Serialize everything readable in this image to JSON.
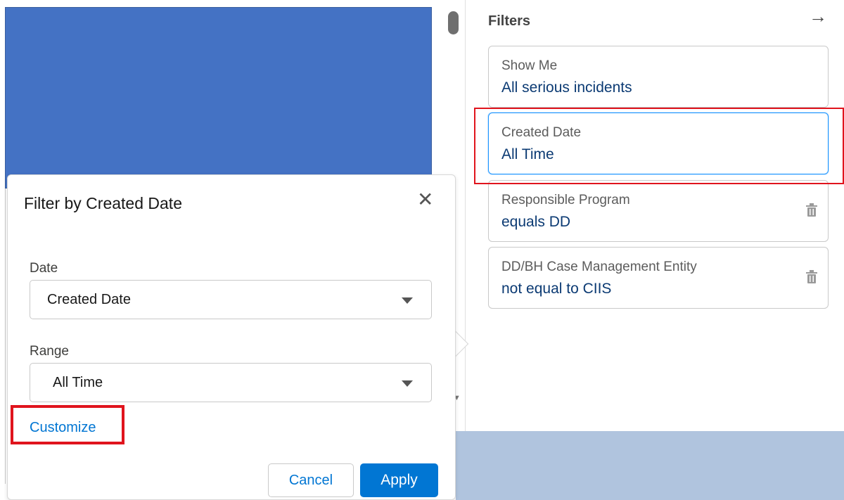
{
  "filters_panel": {
    "title": "Filters",
    "cards": [
      {
        "label": "Show Me",
        "value": "All serious incidents"
      },
      {
        "label": "Created Date",
        "value": "All Time"
      },
      {
        "label": "Responsible Program",
        "value": "equals DD"
      },
      {
        "label": "DD/BH Case Management Entity",
        "value": "not equal to CIIS"
      }
    ]
  },
  "popover": {
    "title": "Filter by Created Date",
    "date_label": "Date",
    "date_value": "Created Date",
    "range_label": "Range",
    "range_value": "All Time",
    "customize_label": "Customize",
    "cancel_label": "Cancel",
    "apply_label": "Apply"
  },
  "colors": {
    "accent": "#0176d3",
    "highlight": "#e0141d",
    "blue_block": "#4472c4",
    "bottom_strip": "#b0c4de"
  },
  "icons": {
    "close": "close-icon",
    "collapse": "arrow-right-icon",
    "delete": "trash-icon",
    "dropdown": "caret-down-icon"
  }
}
